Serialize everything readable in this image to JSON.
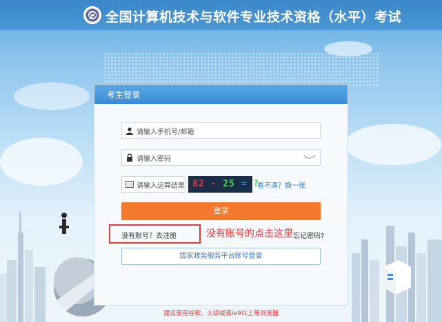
{
  "header": {
    "title": "全国计算机技术与软件专业技术资格（水平）考试",
    "logo_icon": "exam-seal-logo-icon"
  },
  "login": {
    "panel_title": "考生登录",
    "phone_email_placeholder": "请输入手机号/邮箱",
    "password_placeholder": "请输入密码",
    "captcha_placeholder": "请输入运算结果",
    "captcha_text": {
      "part1": "82",
      "op1": "-",
      "part2": "25",
      "op2": "=",
      "part3": "?"
    },
    "refresh_captcha": "看不清？换一张",
    "login_button": "登录",
    "register_link": "没有账号？去注册",
    "forgot_password": "忘记密码?",
    "gov_login_button": "国家政务服务平台账号登录"
  },
  "annotation": "没有账号的点击这里",
  "footer": {
    "browser_note": "建议使用谷歌、火狐或者ie9以上等浏览器"
  },
  "colors": {
    "header_bg": "#3a86c8",
    "login_button": "#f37a2c",
    "annotation": "#e53a3a",
    "link": "#2f7fc5"
  }
}
